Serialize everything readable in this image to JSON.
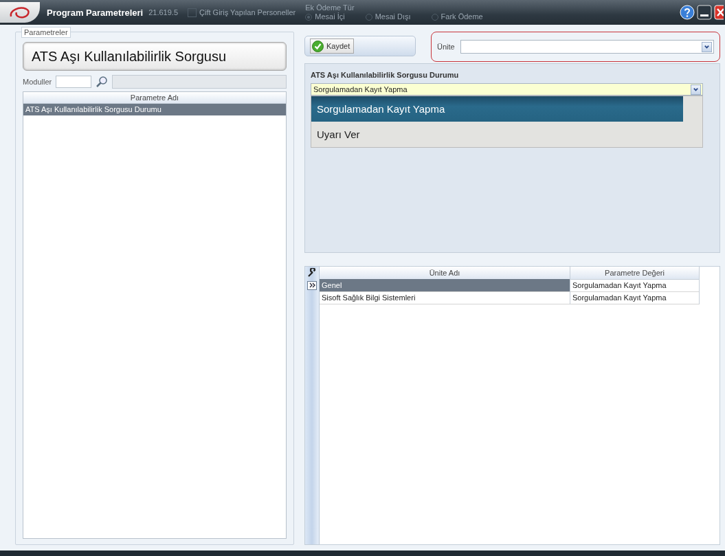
{
  "window": {
    "title": "Program Parametreleri"
  },
  "background_form": {
    "version": "21.619.5",
    "checkbox": {
      "label": "Çift Giriş Yapılan Personeller",
      "checked": false
    },
    "payment_type": {
      "label": "Ek Ödeme Tür",
      "options": [
        {
          "label": "Mesai İçi",
          "selected": true
        },
        {
          "label": "Mesai Dışı",
          "selected": false
        },
        {
          "label": "Fark Ödeme",
          "selected": false
        }
      ]
    }
  },
  "parameters_panel": {
    "legend": "Parametreler",
    "heading": "ATS Aşı Kullanılabilirlik Sorgusu",
    "modules_label": "Moduller",
    "list": {
      "column": "Parametre Adı",
      "rows": [
        {
          "label": "ATS Aşı Kullanılabilirlik Sorgusu Durumu",
          "selected": true
        }
      ]
    }
  },
  "toolbar": {
    "save_button": "Kaydet"
  },
  "unit_filter": {
    "label": "Ünite"
  },
  "editor": {
    "title": "ATS Aşı Kullanılabilirlik Sorgusu Durumu",
    "value": "Sorgulamadan Kayıt Yapma",
    "options": [
      {
        "label": "Sorgulamadan Kayıt Yapma",
        "selected": true
      },
      {
        "label": "Uyarı Ver",
        "selected": false
      }
    ]
  },
  "units_table": {
    "columns": [
      "Ünite Adı",
      "Parametre Değeri"
    ],
    "rows": [
      {
        "cells": [
          "Genel",
          "Sorgulamadan Kayıt Yapma"
        ],
        "selected": true
      },
      {
        "cells": [
          "Sisoft Sağlık Bilgi Sistemleri",
          "Sorgulamadan Kayıt Yapma"
        ],
        "selected": false
      }
    ]
  }
}
